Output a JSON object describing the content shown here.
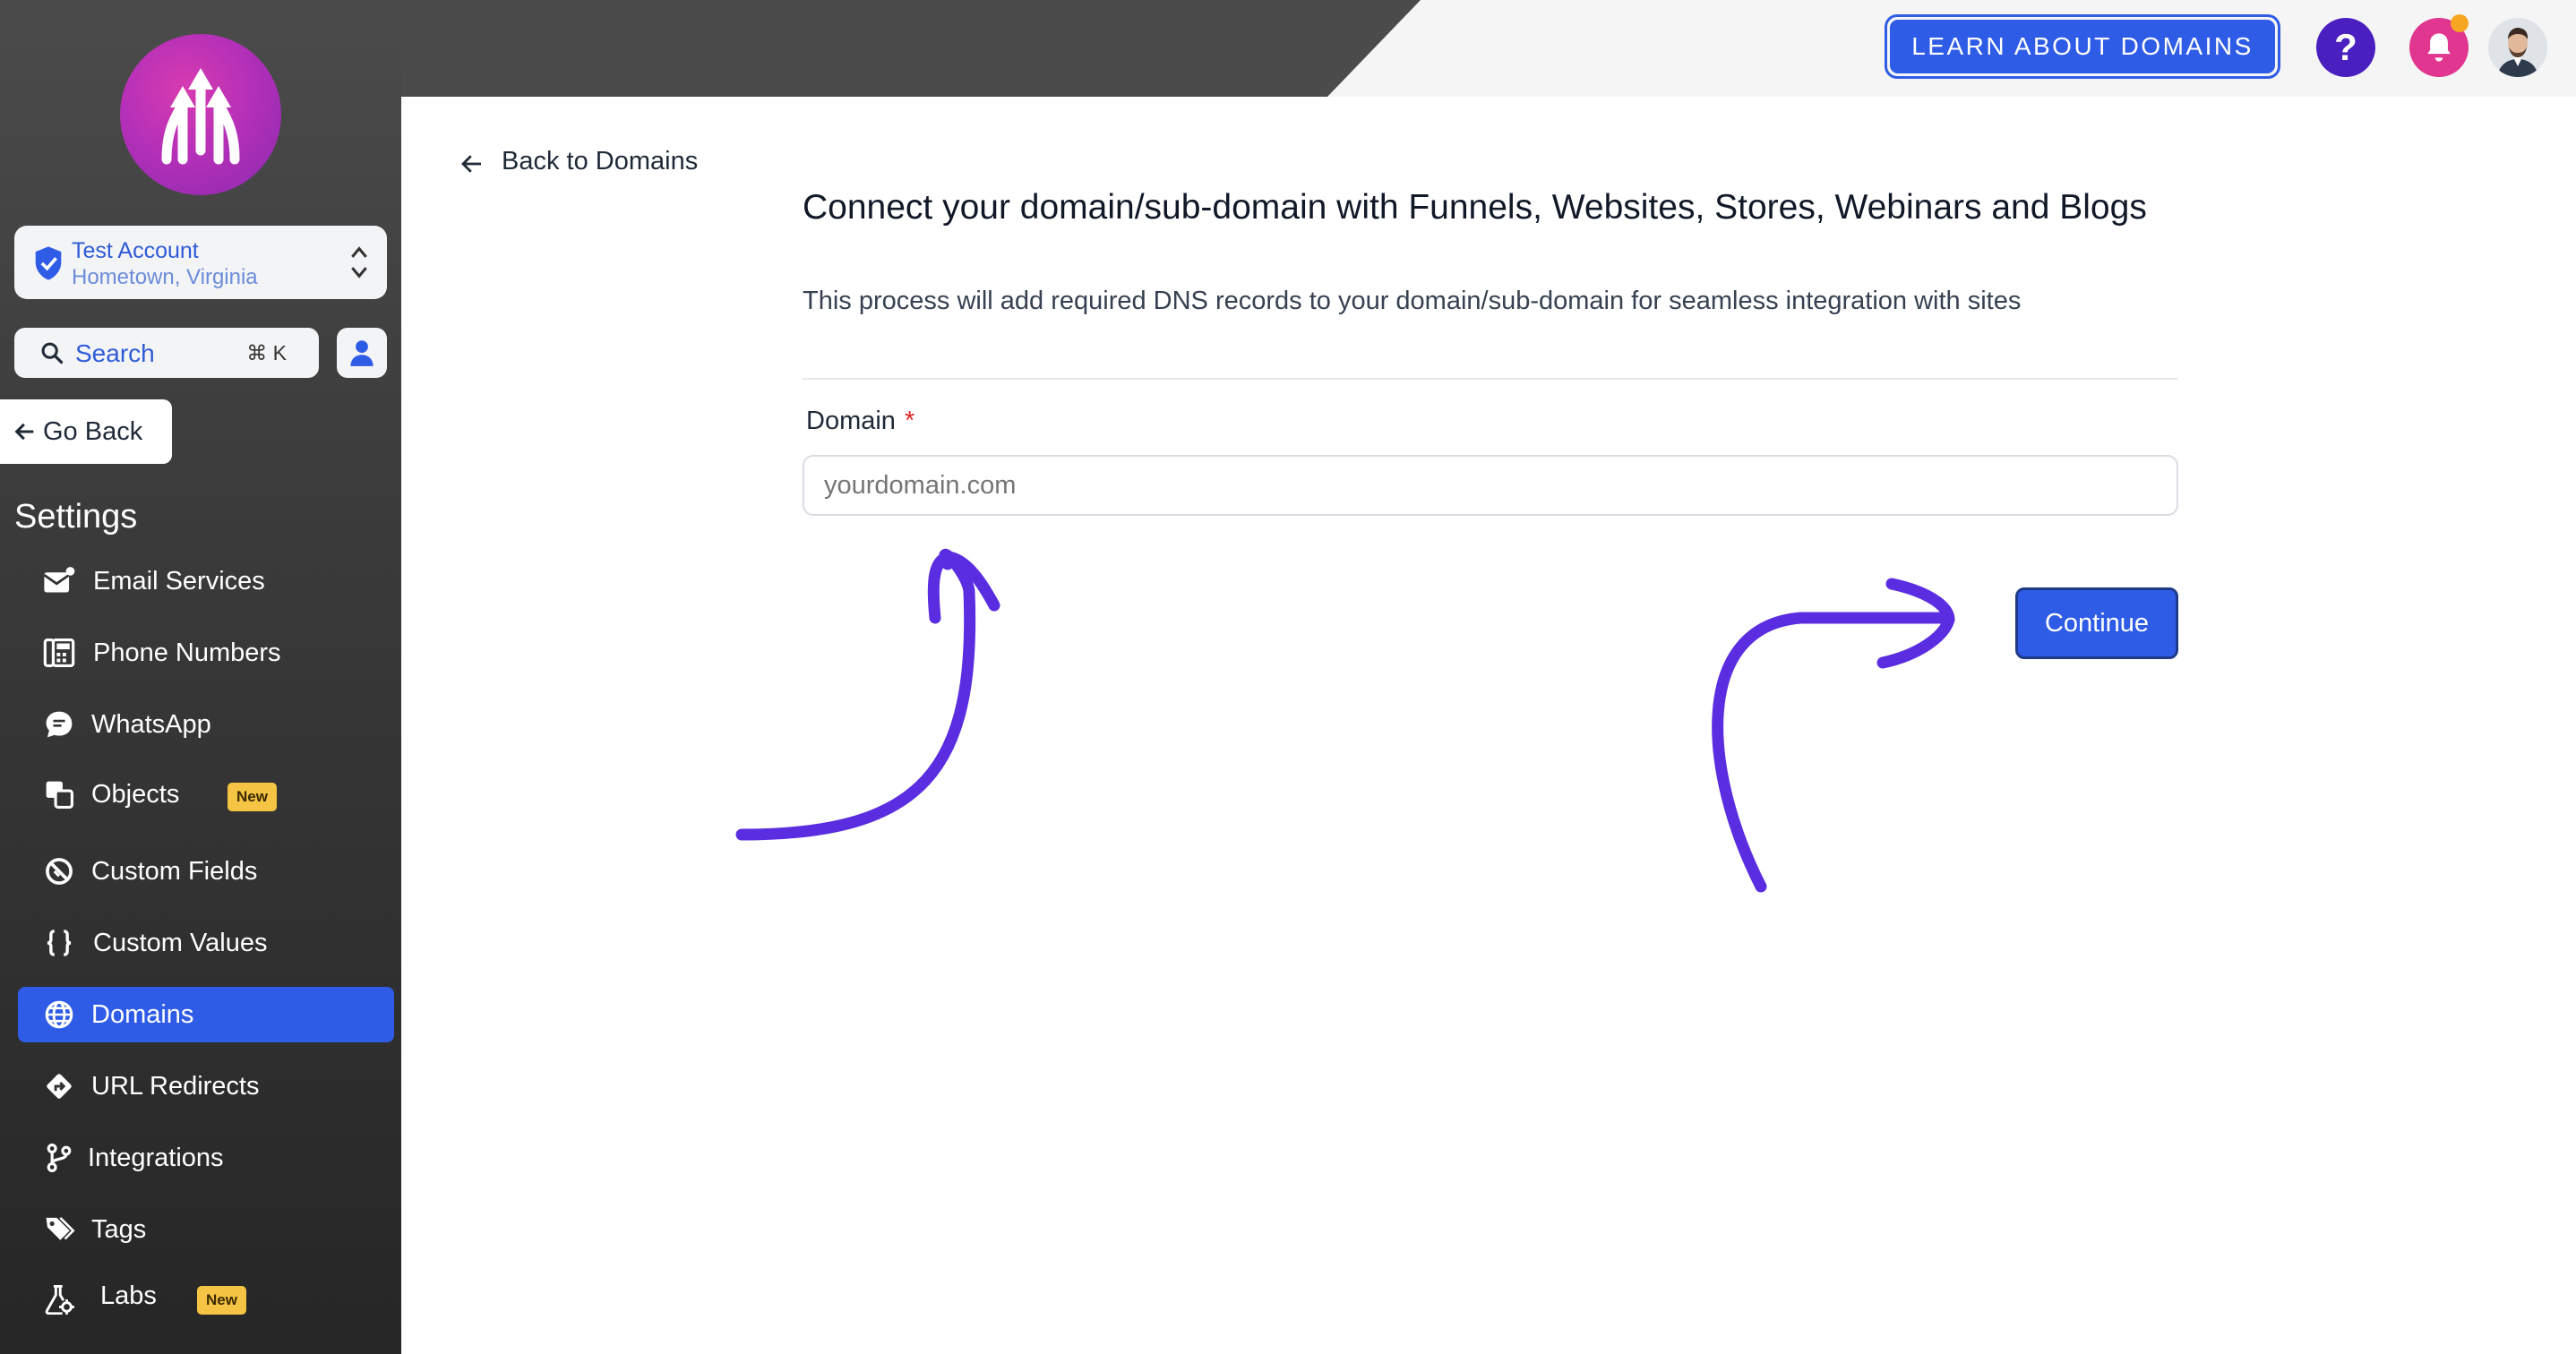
{
  "colors": {
    "accent": "#2f5ce6",
    "sidebar_bg": "#3a3a3a",
    "annotation_arrow": "#5a2ee0",
    "badge": "#f6c444",
    "help_button": "#4a1fc0",
    "bell_button": "#e0368f"
  },
  "sidebar": {
    "logo_icon": "upward-arrows-logo",
    "account": {
      "name": "Test Account",
      "location": "Hometown, Virginia"
    },
    "search": {
      "label": "Search",
      "shortcut": "⌘ K"
    },
    "go_back": "Go Back",
    "section_title": "Settings",
    "items": [
      {
        "label": "Email Services",
        "icon": "envelope-icon"
      },
      {
        "label": "Phone Numbers",
        "icon": "phone-numbers-icon"
      },
      {
        "label": "WhatsApp",
        "icon": "chat-icon"
      },
      {
        "label": "Objects",
        "icon": "objects-icon",
        "badge": "New"
      },
      {
        "label": "Custom Fields",
        "icon": "custom-fields-icon"
      },
      {
        "label": "Custom Values",
        "icon": "braces-icon"
      },
      {
        "label": "Domains",
        "icon": "globe-icon",
        "active": true
      },
      {
        "label": "URL Redirects",
        "icon": "redirect-icon"
      },
      {
        "label": "Integrations",
        "icon": "branch-icon"
      },
      {
        "label": "Tags",
        "icon": "tags-icon"
      },
      {
        "label": "Labs",
        "icon": "flask-icon",
        "badge": "New"
      }
    ]
  },
  "header": {
    "learn_button": "LEARN ABOUT DOMAINS",
    "help_label": "?"
  },
  "main": {
    "back_link": "Back to Domains",
    "heading": "Connect your domain/sub-domain with Funnels, Websites, Stores, Webinars and Blogs",
    "subheading": "This process will add required DNS records to your domain/sub-domain for seamless integration with sites",
    "domain_label": "Domain",
    "required_marker": "*",
    "domain_placeholder": "yourdomain.com",
    "continue_button": "Continue"
  }
}
